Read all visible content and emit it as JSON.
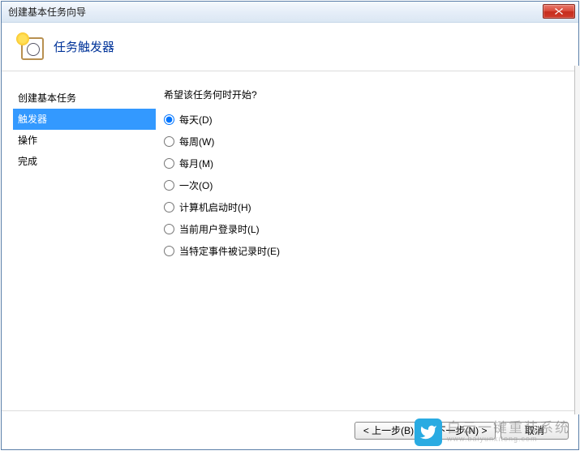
{
  "titlebar": {
    "title": "创建基本任务向导"
  },
  "header": {
    "title": "任务触发器"
  },
  "sidebar": {
    "items": [
      {
        "label": "创建基本任务",
        "selected": false
      },
      {
        "label": "触发器",
        "selected": true
      },
      {
        "label": "操作",
        "selected": false
      },
      {
        "label": "完成",
        "selected": false
      }
    ]
  },
  "main": {
    "prompt": "希望该任务何时开始?",
    "options": [
      {
        "label": "每天(D)",
        "value": "daily",
        "selected": true
      },
      {
        "label": "每周(W)",
        "value": "weekly",
        "selected": false
      },
      {
        "label": "每月(M)",
        "value": "monthly",
        "selected": false
      },
      {
        "label": "一次(O)",
        "value": "once",
        "selected": false
      },
      {
        "label": "计算机启动时(H)",
        "value": "startup",
        "selected": false
      },
      {
        "label": "当前用户登录时(L)",
        "value": "logon",
        "selected": false
      },
      {
        "label": "当特定事件被记录时(E)",
        "value": "event",
        "selected": false
      }
    ]
  },
  "footer": {
    "back_label": "< 上一步(B)",
    "next_label": "下一步(N) >",
    "cancel_label": "取消"
  },
  "watermark": {
    "main": "白云一键重装系统",
    "sub": "www.baiyunxitong.com"
  }
}
